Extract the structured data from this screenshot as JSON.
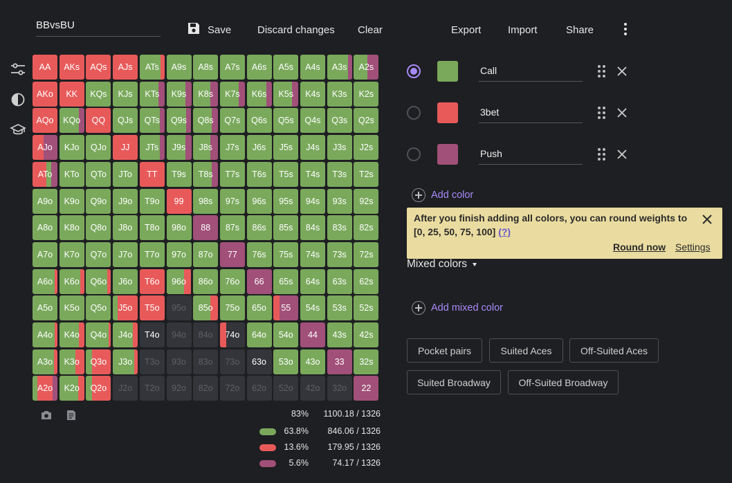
{
  "header": {
    "range_name": "BBvsBU",
    "save_label": "Save",
    "discard_label": "Discard changes",
    "clear_label": "Clear",
    "export_label": "Export",
    "import_label": "Import",
    "share_label": "Share"
  },
  "sidebar": {
    "icons": [
      "sliders-icon",
      "contrast-icon",
      "graduation-cap-icon"
    ]
  },
  "palette": {
    "green": "#7aa95c",
    "red": "#e85a5a",
    "purple": "#a15079",
    "empty": "#33353a"
  },
  "grid": {
    "ranks": [
      "A",
      "K",
      "Q",
      "J",
      "T",
      "9",
      "8",
      "7",
      "6",
      "5",
      "4",
      "3",
      "2"
    ],
    "mixes": {
      "ATs": [
        [
          0.85,
          "green"
        ],
        [
          0.15,
          "red"
        ]
      ],
      "A3s": [
        [
          0.85,
          "green"
        ],
        [
          0.15,
          "purple"
        ]
      ],
      "A2s": [
        [
          0.55,
          "green"
        ],
        [
          0.45,
          "purple"
        ]
      ],
      "KTs": [
        [
          0.75,
          "green"
        ],
        [
          0.25,
          "purple"
        ]
      ],
      "K9s": [
        [
          0.75,
          "green"
        ],
        [
          0.25,
          "purple"
        ]
      ],
      "K8s": [
        [
          0.7,
          "green"
        ],
        [
          0.3,
          "purple"
        ]
      ],
      "K7s": [
        [
          0.75,
          "green"
        ],
        [
          0.25,
          "purple"
        ]
      ],
      "K6s": [
        [
          0.8,
          "green"
        ],
        [
          0.2,
          "purple"
        ]
      ],
      "K5s": [
        [
          0.75,
          "green"
        ],
        [
          0.25,
          "purple"
        ]
      ],
      "KQo": [
        [
          0.8,
          "green"
        ],
        [
          0.2,
          "purple"
        ]
      ],
      "QTs": [
        [
          0.8,
          "green"
        ],
        [
          0.2,
          "purple"
        ]
      ],
      "Q9s": [
        [
          0.8,
          "green"
        ],
        [
          0.2,
          "purple"
        ]
      ],
      "Q8s": [
        [
          0.75,
          "green"
        ],
        [
          0.25,
          "purple"
        ]
      ],
      "AJo": [
        [
          0.45,
          "red"
        ],
        [
          0.55,
          "purple"
        ]
      ],
      "JTs": [
        [
          0.8,
          "green"
        ],
        [
          0.2,
          "purple"
        ]
      ],
      "J9s": [
        [
          0.75,
          "green"
        ],
        [
          0.25,
          "purple"
        ]
      ],
      "J8s": [
        [
          0.7,
          "green"
        ],
        [
          0.3,
          "purple"
        ]
      ],
      "ATo": [
        [
          0.55,
          "red"
        ],
        [
          0.2,
          "green"
        ],
        [
          0.25,
          "purple"
        ]
      ],
      "T8s": [
        [
          0.75,
          "green"
        ],
        [
          0.25,
          "purple"
        ]
      ],
      "A6o": [
        [
          0.9,
          "green"
        ],
        [
          0.1,
          "red"
        ]
      ],
      "K6o": [
        [
          0.85,
          "green"
        ],
        [
          0.15,
          "red"
        ]
      ],
      "Q6o": [
        [
          0.85,
          "green"
        ],
        [
          0.15,
          "red"
        ]
      ],
      "96o": [
        [
          0.7,
          "green"
        ],
        [
          0.3,
          "red"
        ]
      ],
      "J5o": [
        [
          0.2,
          "green"
        ],
        [
          0.8,
          "red"
        ]
      ],
      "85o": [
        [
          0.7,
          "green"
        ],
        [
          0.3,
          "red"
        ]
      ],
      "55": [
        [
          0.25,
          "red"
        ],
        [
          0.75,
          "purple"
        ]
      ],
      "A4o": [
        [
          0.9,
          "green"
        ],
        [
          0.1,
          "red"
        ]
      ],
      "K4o": [
        [
          0.8,
          "green"
        ],
        [
          0.2,
          "red"
        ]
      ],
      "Q4o": [
        [
          0.9,
          "green"
        ],
        [
          0.1,
          "red"
        ]
      ],
      "J4o": [
        [
          0.8,
          "green"
        ],
        [
          0.2,
          "red"
        ]
      ],
      "74o": [
        [
          0.25,
          "red"
        ],
        [
          0.75,
          "empty"
        ]
      ],
      "A3o": [
        [
          0.85,
          "green"
        ],
        [
          0.15,
          "red"
        ]
      ],
      "K3o": [
        [
          0.65,
          "green"
        ],
        [
          0.35,
          "red"
        ]
      ],
      "Q3o": [
        [
          0.25,
          "green"
        ],
        [
          0.75,
          "red"
        ]
      ],
      "J3o": [
        [
          0.85,
          "green"
        ],
        [
          0.15,
          "red"
        ]
      ],
      "A2o": [
        [
          0.2,
          "green"
        ],
        [
          0.6,
          "red"
        ],
        [
          0.2,
          "purple"
        ]
      ],
      "K2o": [
        [
          0.75,
          "green"
        ],
        [
          0.25,
          "red"
        ]
      ],
      "Q2o": [
        [
          0.25,
          "green"
        ],
        [
          0.75,
          "red"
        ]
      ]
    },
    "solid": {
      "AA": "red",
      "AKs": "red",
      "AQs": "red",
      "AJs": "red",
      "AKo": "red",
      "KK": "red",
      "AQo": "red",
      "QQ": "red",
      "JJ": "red",
      "TT": "red",
      "99": "red",
      "T6o": "red",
      "T5o": "red",
      "88": "purple",
      "77": "purple",
      "66": "purple",
      "44": "purple",
      "33": "purple",
      "22": "purple",
      "95o": "empty",
      "94o": "empty",
      "84o": "empty",
      "T4o": "empty",
      "63o": "empty",
      "J2o": "empty",
      "T2o": "empty",
      "92o": "empty",
      "82o": "empty",
      "72o": "empty",
      "62o": "empty",
      "52o": "empty",
      "42o": "empty",
      "32o": "empty",
      "T3o": "empty",
      "93o": "empty",
      "83o": "empty",
      "73o": "empty"
    },
    "dim_labels": [
      "95o",
      "94o",
      "84o",
      "J2o",
      "T2o",
      "92o",
      "82o",
      "72o",
      "62o",
      "52o",
      "42o",
      "32o",
      "T3o",
      "93o",
      "83o",
      "73o"
    ]
  },
  "stats": {
    "total_pct": "83%",
    "total_count": "1100.18 / 1326",
    "rows": [
      {
        "color": "#7aa95c",
        "pct": "63.8%",
        "count": "846.06 / 1326"
      },
      {
        "color": "#e85a5a",
        "pct": "13.6%",
        "count": "179.95 / 1326"
      },
      {
        "color": "#a15079",
        "pct": "5.6%",
        "count": "74.17 / 1326"
      }
    ]
  },
  "colors": [
    {
      "name": "Call",
      "color": "#7aa95c",
      "selected": true
    },
    {
      "name": "3bet",
      "color": "#e85a5a",
      "selected": false
    },
    {
      "name": "Push",
      "color": "#a15079",
      "selected": false
    }
  ],
  "add_color_label": "Add color",
  "notice": {
    "text": "After you finish adding all colors, you can round weights to [0, 25, 50, 75, 100]",
    "help": "(?)",
    "round_now": "Round now",
    "settings": "Settings"
  },
  "mixed_colors_label": "Mixed colors",
  "add_mixed_color_label": "Add mixed color",
  "presets": [
    "Pocket pairs",
    "Suited Aces",
    "Off-Suited Aces",
    "Suited Broadway",
    "Off-Suited Broadway"
  ]
}
